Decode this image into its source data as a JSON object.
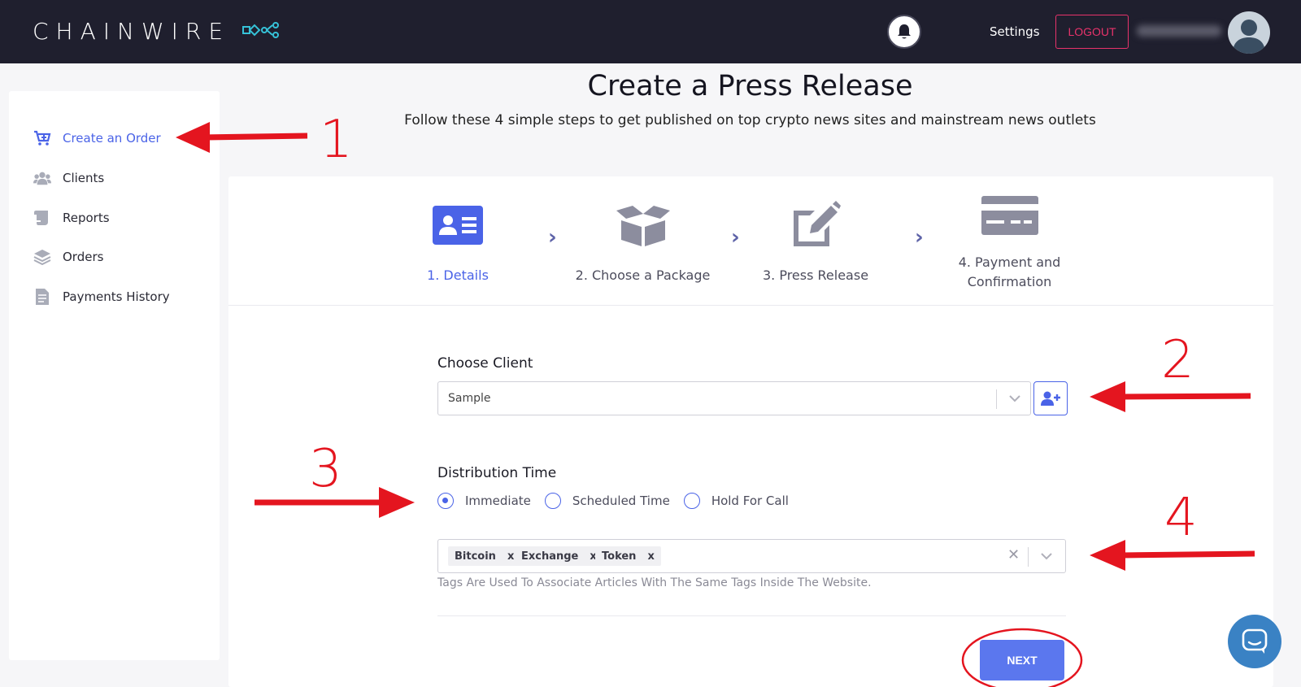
{
  "header": {
    "brand": "CHAINWIRE",
    "settings_label": "Settings",
    "logout_label": "LOGOUT"
  },
  "sidebar": {
    "items": [
      {
        "label": "Create an Order",
        "icon": "cart-plus-icon",
        "active": true
      },
      {
        "label": "Clients",
        "icon": "users-icon",
        "active": false
      },
      {
        "label": "Reports",
        "icon": "scroll-icon",
        "active": false
      },
      {
        "label": "Orders",
        "icon": "layers-icon",
        "active": false
      },
      {
        "label": "Payments History",
        "icon": "document-icon",
        "active": false
      }
    ]
  },
  "page": {
    "title": "Create a Press Release",
    "subtitle": "Follow these 4 simple steps to get published on top crypto news sites and mainstream news outlets"
  },
  "steps": [
    {
      "label": "1. Details",
      "icon": "id-card-icon",
      "active": true
    },
    {
      "label": "2. Choose a Package",
      "icon": "open-box-icon",
      "active": false
    },
    {
      "label": "3. Press Release",
      "icon": "edit-icon",
      "active": false
    },
    {
      "label_line1": "4. Payment and",
      "label_line2": "Confirmation",
      "icon": "credit-card-icon",
      "active": false
    }
  ],
  "form": {
    "client_label": "Choose Client",
    "client_value": "Sample",
    "distribution_label": "Distribution Time",
    "distribution_options": [
      {
        "label": "Immediate",
        "checked": true
      },
      {
        "label": "Scheduled Time",
        "checked": false
      },
      {
        "label": "Hold For Call",
        "checked": false
      }
    ],
    "tags": [
      "Bitcoin",
      "Exchange",
      "Token"
    ],
    "tag_remove": "x",
    "tags_help": "Tags Are Used To Associate Articles With The Same Tags Inside The Website.",
    "next_label": "NEXT"
  },
  "annotations": {
    "numbers": [
      "1",
      "2",
      "3",
      "4"
    ],
    "color": "#e4151f"
  },
  "colors": {
    "accent": "#4a63e7",
    "header_bg": "#1f1f2e",
    "logout": "#e8336b",
    "next_button": "#5b77ee"
  }
}
